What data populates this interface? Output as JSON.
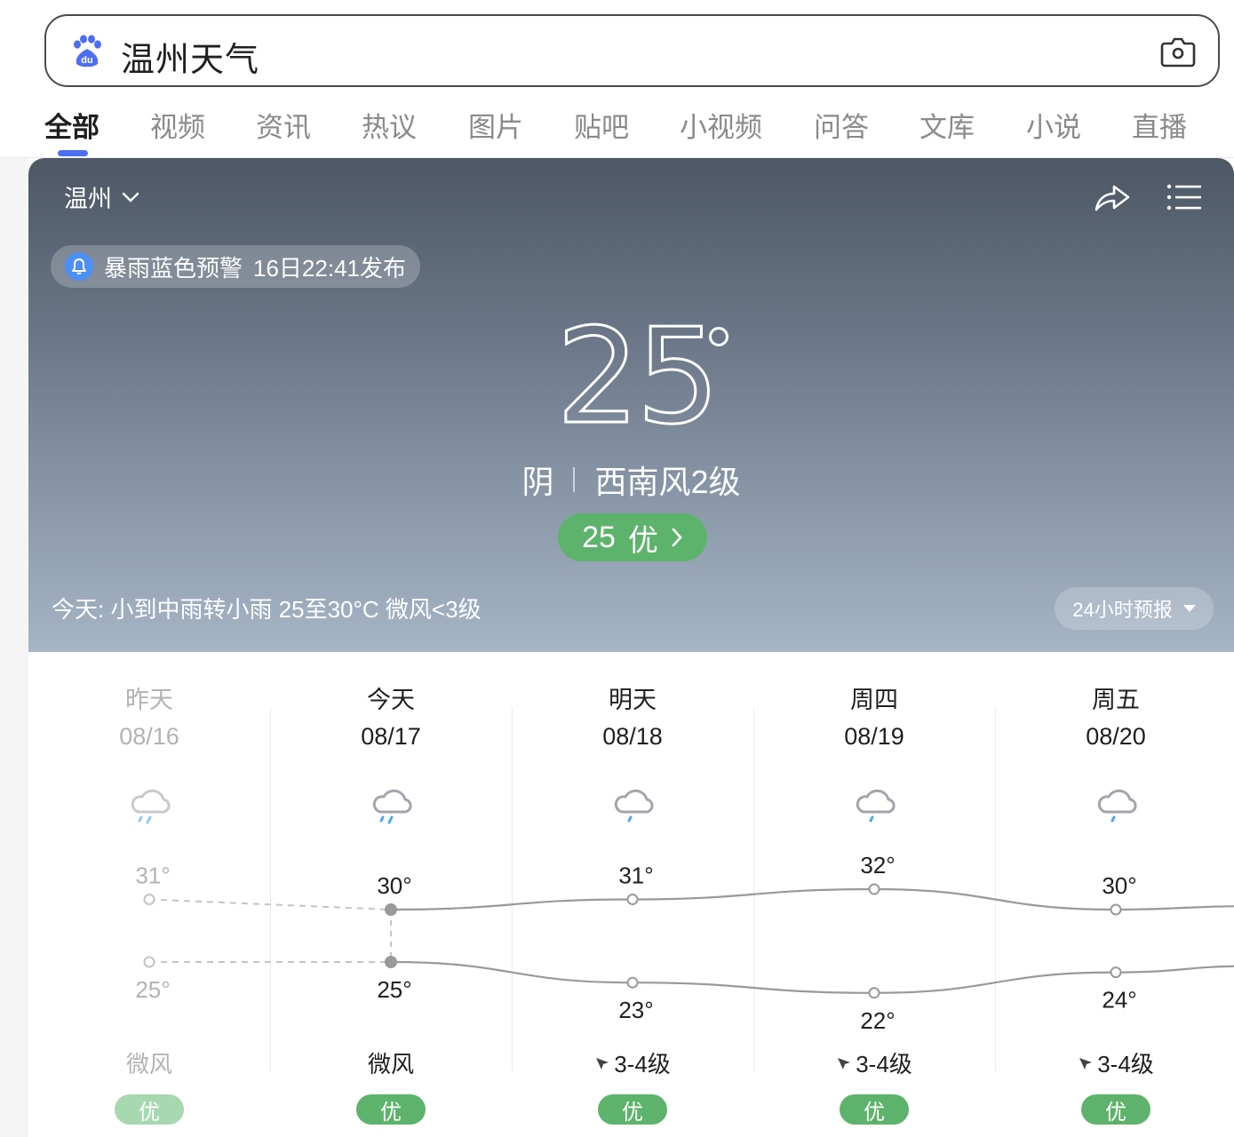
{
  "search": {
    "query": "温州天气",
    "logo_icon": "baidu-paw-icon",
    "camera_icon": "camera-icon"
  },
  "tabs": [
    {
      "label": "全部",
      "active": true
    },
    {
      "label": "视频",
      "active": false
    },
    {
      "label": "资讯",
      "active": false
    },
    {
      "label": "热议",
      "active": false
    },
    {
      "label": "图片",
      "active": false
    },
    {
      "label": "贴吧",
      "active": false
    },
    {
      "label": "小视频",
      "active": false
    },
    {
      "label": "问答",
      "active": false
    },
    {
      "label": "文库",
      "active": false
    },
    {
      "label": "小说",
      "active": false
    },
    {
      "label": "直播",
      "active": false
    }
  ],
  "weather": {
    "city": "温州",
    "alert": {
      "title": "暴雨蓝色预警",
      "time": "16日22:41发布",
      "icon": "bell-icon"
    },
    "current_temp": "25",
    "condition": "阴",
    "wind": "西南风2级",
    "aqi": {
      "value": "25",
      "label": "优"
    },
    "today_summary": "今天: 小到中雨转小雨  25至30°C  微风<3级",
    "hourly_button": "24小时预报"
  },
  "forecast": [
    {
      "day": "昨天",
      "date": "08/16",
      "icon": "moderate-rain-icon",
      "high": 31,
      "low": 25,
      "high_label": "31°",
      "low_label": "25°",
      "wind": "微风",
      "wind_arrow": false,
      "aqi": "优",
      "past": true
    },
    {
      "day": "今天",
      "date": "08/17",
      "icon": "moderate-rain-icon",
      "high": 30,
      "low": 25,
      "high_label": "30°",
      "low_label": "25°",
      "wind": "微风",
      "wind_arrow": false,
      "aqi": "优",
      "past": false
    },
    {
      "day": "明天",
      "date": "08/18",
      "icon": "light-rain-icon",
      "high": 31,
      "low": 23,
      "high_label": "31°",
      "low_label": "23°",
      "wind": "3-4级",
      "wind_arrow": true,
      "aqi": "优",
      "past": false
    },
    {
      "day": "周四",
      "date": "08/19",
      "icon": "light-rain-icon",
      "high": 32,
      "low": 22,
      "high_label": "32°",
      "low_label": "22°",
      "wind": "3-4级",
      "wind_arrow": true,
      "aqi": "优",
      "past": false
    },
    {
      "day": "周五",
      "date": "08/20",
      "icon": "light-rain-icon",
      "high": 30,
      "low": 24,
      "high_label": "30°",
      "low_label": "24°",
      "wind": "3-4级",
      "wind_arrow": true,
      "aqi": "优",
      "past": false
    }
  ],
  "colors": {
    "accent": "#4e6ef2",
    "aqi_good": "#5db36b",
    "aqi_good_past": "#a8d8b0",
    "alert_blue": "#4d90f5",
    "rain_blue": "#4aa8ec",
    "chart_line": "#999999"
  }
}
